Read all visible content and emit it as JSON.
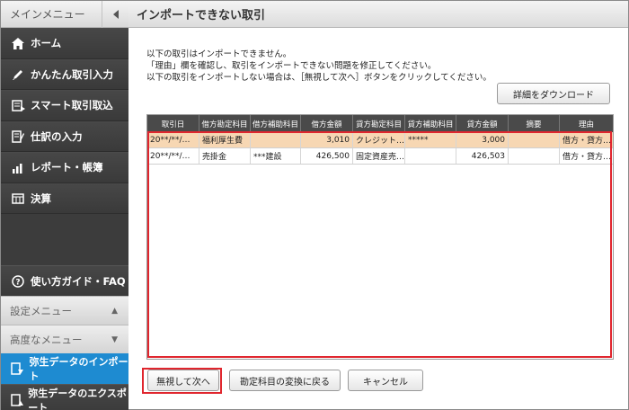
{
  "sidebar": {
    "header": "メインメニュー",
    "items": [
      {
        "label": "ホーム",
        "icon": "home-icon"
      },
      {
        "label": "かんたん取引入力",
        "icon": "pencil-icon"
      },
      {
        "label": "スマート取引取込",
        "icon": "import-icon"
      },
      {
        "label": "仕訳の入力",
        "icon": "journal-icon"
      },
      {
        "label": "レポート・帳簿",
        "icon": "report-icon"
      },
      {
        "label": "決算",
        "icon": "settlement-icon"
      }
    ],
    "help": "使い方ガイド・FAQ",
    "settings_menu": "設定メニュー",
    "advanced_menu": "高度なメニュー",
    "import_item": "弥生データのインポート",
    "export_item": "弥生データのエクスポート"
  },
  "main": {
    "title": "インポートできない取引",
    "message": [
      "以下の取引はインポートできません。",
      "「理由」欄を確認し、取引をインポートできない問題を修正してください。",
      "以下の取引をインポートしない場合は、［無視して次へ］ボタンをクリックしてください。"
    ],
    "download_button": "詳細をダウンロード",
    "columns": [
      "取引日",
      "借方勘定科目",
      "借方補助科目",
      "借方金額",
      "貸方勘定科目",
      "貸方補助科目",
      "貸方金額",
      "摘要",
      "理由"
    ],
    "rows": [
      [
        "20**/**/…",
        "福利厚生費",
        "",
        "3,010",
        "クレジット…",
        "*****",
        "3,000",
        "",
        "借方・貸方…"
      ],
      [
        "20**/**/…",
        "売掛金",
        "***建設",
        "426,500",
        "固定資産売…",
        "",
        "426,503",
        "",
        "借方・貸方…"
      ]
    ],
    "buttons": {
      "skip": "無視して次へ",
      "back": "勘定科目の変換に戻る",
      "cancel": "キャンセル"
    }
  },
  "colors": {
    "accent": "#1e8bd1",
    "highlight": "#e0262e",
    "selected_row": "#f7d7b3"
  }
}
